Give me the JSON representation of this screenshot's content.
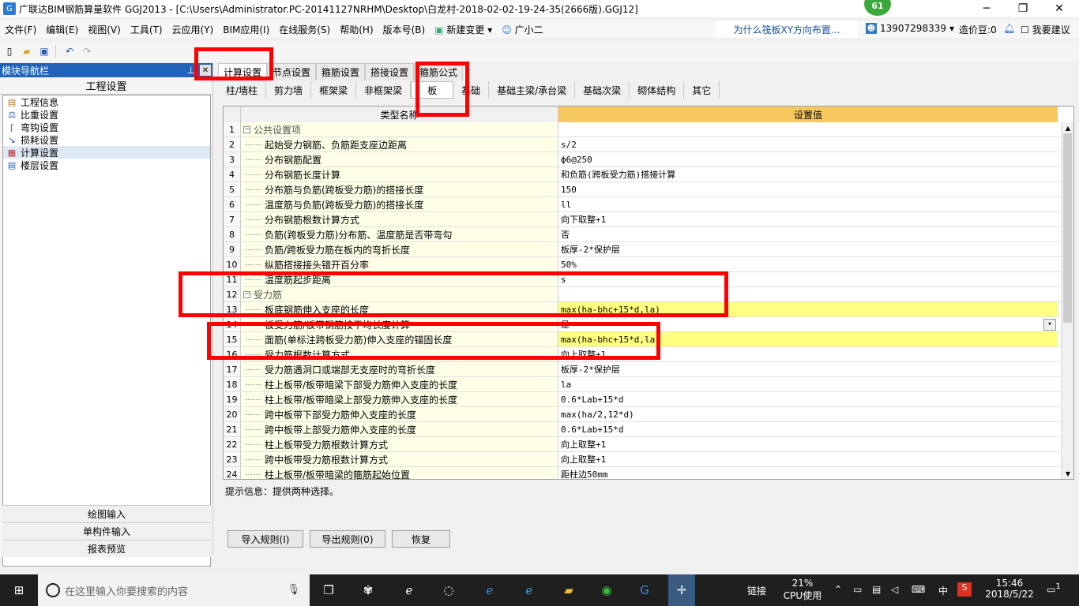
{
  "window": {
    "title": "广联达BIM钢筋算量软件 GGJ2013 - [C:\\Users\\Administrator.PC-20141127NRHM\\Desktop\\白龙村-2018-02-02-19-24-35(2666版).GGJ12]",
    "badge": "61"
  },
  "menu": [
    "文件(F)",
    "编辑(E)",
    "视图(V)",
    "工具(T)",
    "云应用(Y)",
    "BIM应用(I)",
    "在线服务(S)",
    "帮助(H)",
    "版本号(B)",
    "新建变更",
    "广小二"
  ],
  "menu_right": {
    "question": "为什么筏板XY方向布置...",
    "phone": "13907298339",
    "cost_bean": "造价豆:0",
    "suggest": "我要建议"
  },
  "nav": {
    "header": "模块导航栏",
    "section": "工程设置",
    "items": [
      "工程信息",
      "比重设置",
      "弯钩设置",
      "损耗设置",
      "计算设置",
      "楼层设置"
    ],
    "bottom": [
      "绘图输入",
      "单构件输入",
      "报表预览"
    ]
  },
  "tabs_top": [
    "计算设置",
    "节点设置",
    "箍筋设置",
    "搭接设置",
    "箍筋公式"
  ],
  "tabs_sub": [
    "柱/墙柱",
    "剪力墙",
    "框架梁",
    "非框架梁",
    "板",
    "基础",
    "基础主梁/承台梁",
    "基础次梁",
    "砌体结构",
    "其它"
  ],
  "grid": {
    "col_name": "类型名称",
    "col_value": "设置值",
    "rows": [
      {
        "n": "1",
        "name": "公共设置项",
        "value": "",
        "group": true
      },
      {
        "n": "2",
        "name": "起始受力钢筋、负筋距支座边距离",
        "value": "s/2"
      },
      {
        "n": "3",
        "name": "分布钢筋配置",
        "value": "ф6@250"
      },
      {
        "n": "4",
        "name": "分布钢筋长度计算",
        "value": "和负筋(跨板受力筋)搭接计算"
      },
      {
        "n": "5",
        "name": "分布筋与负筋(跨板受力筋)的搭接长度",
        "value": "150"
      },
      {
        "n": "6",
        "name": "温度筋与负筋(跨板受力筋)的搭接长度",
        "value": "ll"
      },
      {
        "n": "7",
        "name": "分布钢筋根数计算方式",
        "value": "向下取整+1"
      },
      {
        "n": "8",
        "name": "负筋(跨板受力筋)分布筋、温度筋是否带弯勾",
        "value": "否"
      },
      {
        "n": "9",
        "name": "负筋/跨板受力筋在板内的弯折长度",
        "value": "板厚-2*保护层"
      },
      {
        "n": "10",
        "name": "纵筋搭接接头错开百分率",
        "value": "50%"
      },
      {
        "n": "11",
        "name": "温度筋起步距离",
        "value": "s"
      },
      {
        "n": "12",
        "name": "受力筋",
        "value": "",
        "group": true
      },
      {
        "n": "13",
        "name": "板底钢筋伸入支座的长度",
        "value": "max(ha-bhc+15*d,la)",
        "selected": true
      },
      {
        "n": "14",
        "name": "板受力筋/板带钢筋按平均长度计算",
        "value": "是",
        "dropdown": true
      },
      {
        "n": "15",
        "name": "面筋(单标注跨板受力筋)伸入支座的锚固长度",
        "value": "max(ha-bhc+15*d,la)",
        "selected": true
      },
      {
        "n": "16",
        "name": "受力筋根数计算方式",
        "value": "向上取整+1"
      },
      {
        "n": "17",
        "name": "受力筋遇洞口或端部无支座时的弯折长度",
        "value": "板厚-2*保护层"
      },
      {
        "n": "18",
        "name": "柱上板带/板带暗梁下部受力筋伸入支座的长度",
        "value": "la"
      },
      {
        "n": "19",
        "name": "柱上板带/板带暗梁上部受力筋伸入支座的长度",
        "value": "0.6*Lab+15*d"
      },
      {
        "n": "20",
        "name": "跨中板带下部受力筋伸入支座的长度",
        "value": "max(ha/2,12*d)"
      },
      {
        "n": "21",
        "name": "跨中板带上部受力筋伸入支座的长度",
        "value": "0.6*Lab+15*d"
      },
      {
        "n": "22",
        "name": "柱上板带受力筋根数计算方式",
        "value": "向上取整+1"
      },
      {
        "n": "23",
        "name": "跨中板带受力筋根数计算方式",
        "value": "向上取整+1"
      },
      {
        "n": "24",
        "name": "柱上板带/板带暗梁的箍筋起始位置",
        "value": "距柱边50mm"
      }
    ]
  },
  "hint": "提示信息：提供两种选择。",
  "buttons": {
    "import": "导入规则(I)",
    "export": "导出规则(0)",
    "restore": "恢复"
  },
  "taskbar": {
    "search_placeholder": "在这里输入你要搜索的内容",
    "link": "链接",
    "cpu_pct": "21%",
    "cpu_label": "CPU使用",
    "ime": "中",
    "time": "15:46",
    "date": "2018/5/22",
    "notif": "1"
  }
}
